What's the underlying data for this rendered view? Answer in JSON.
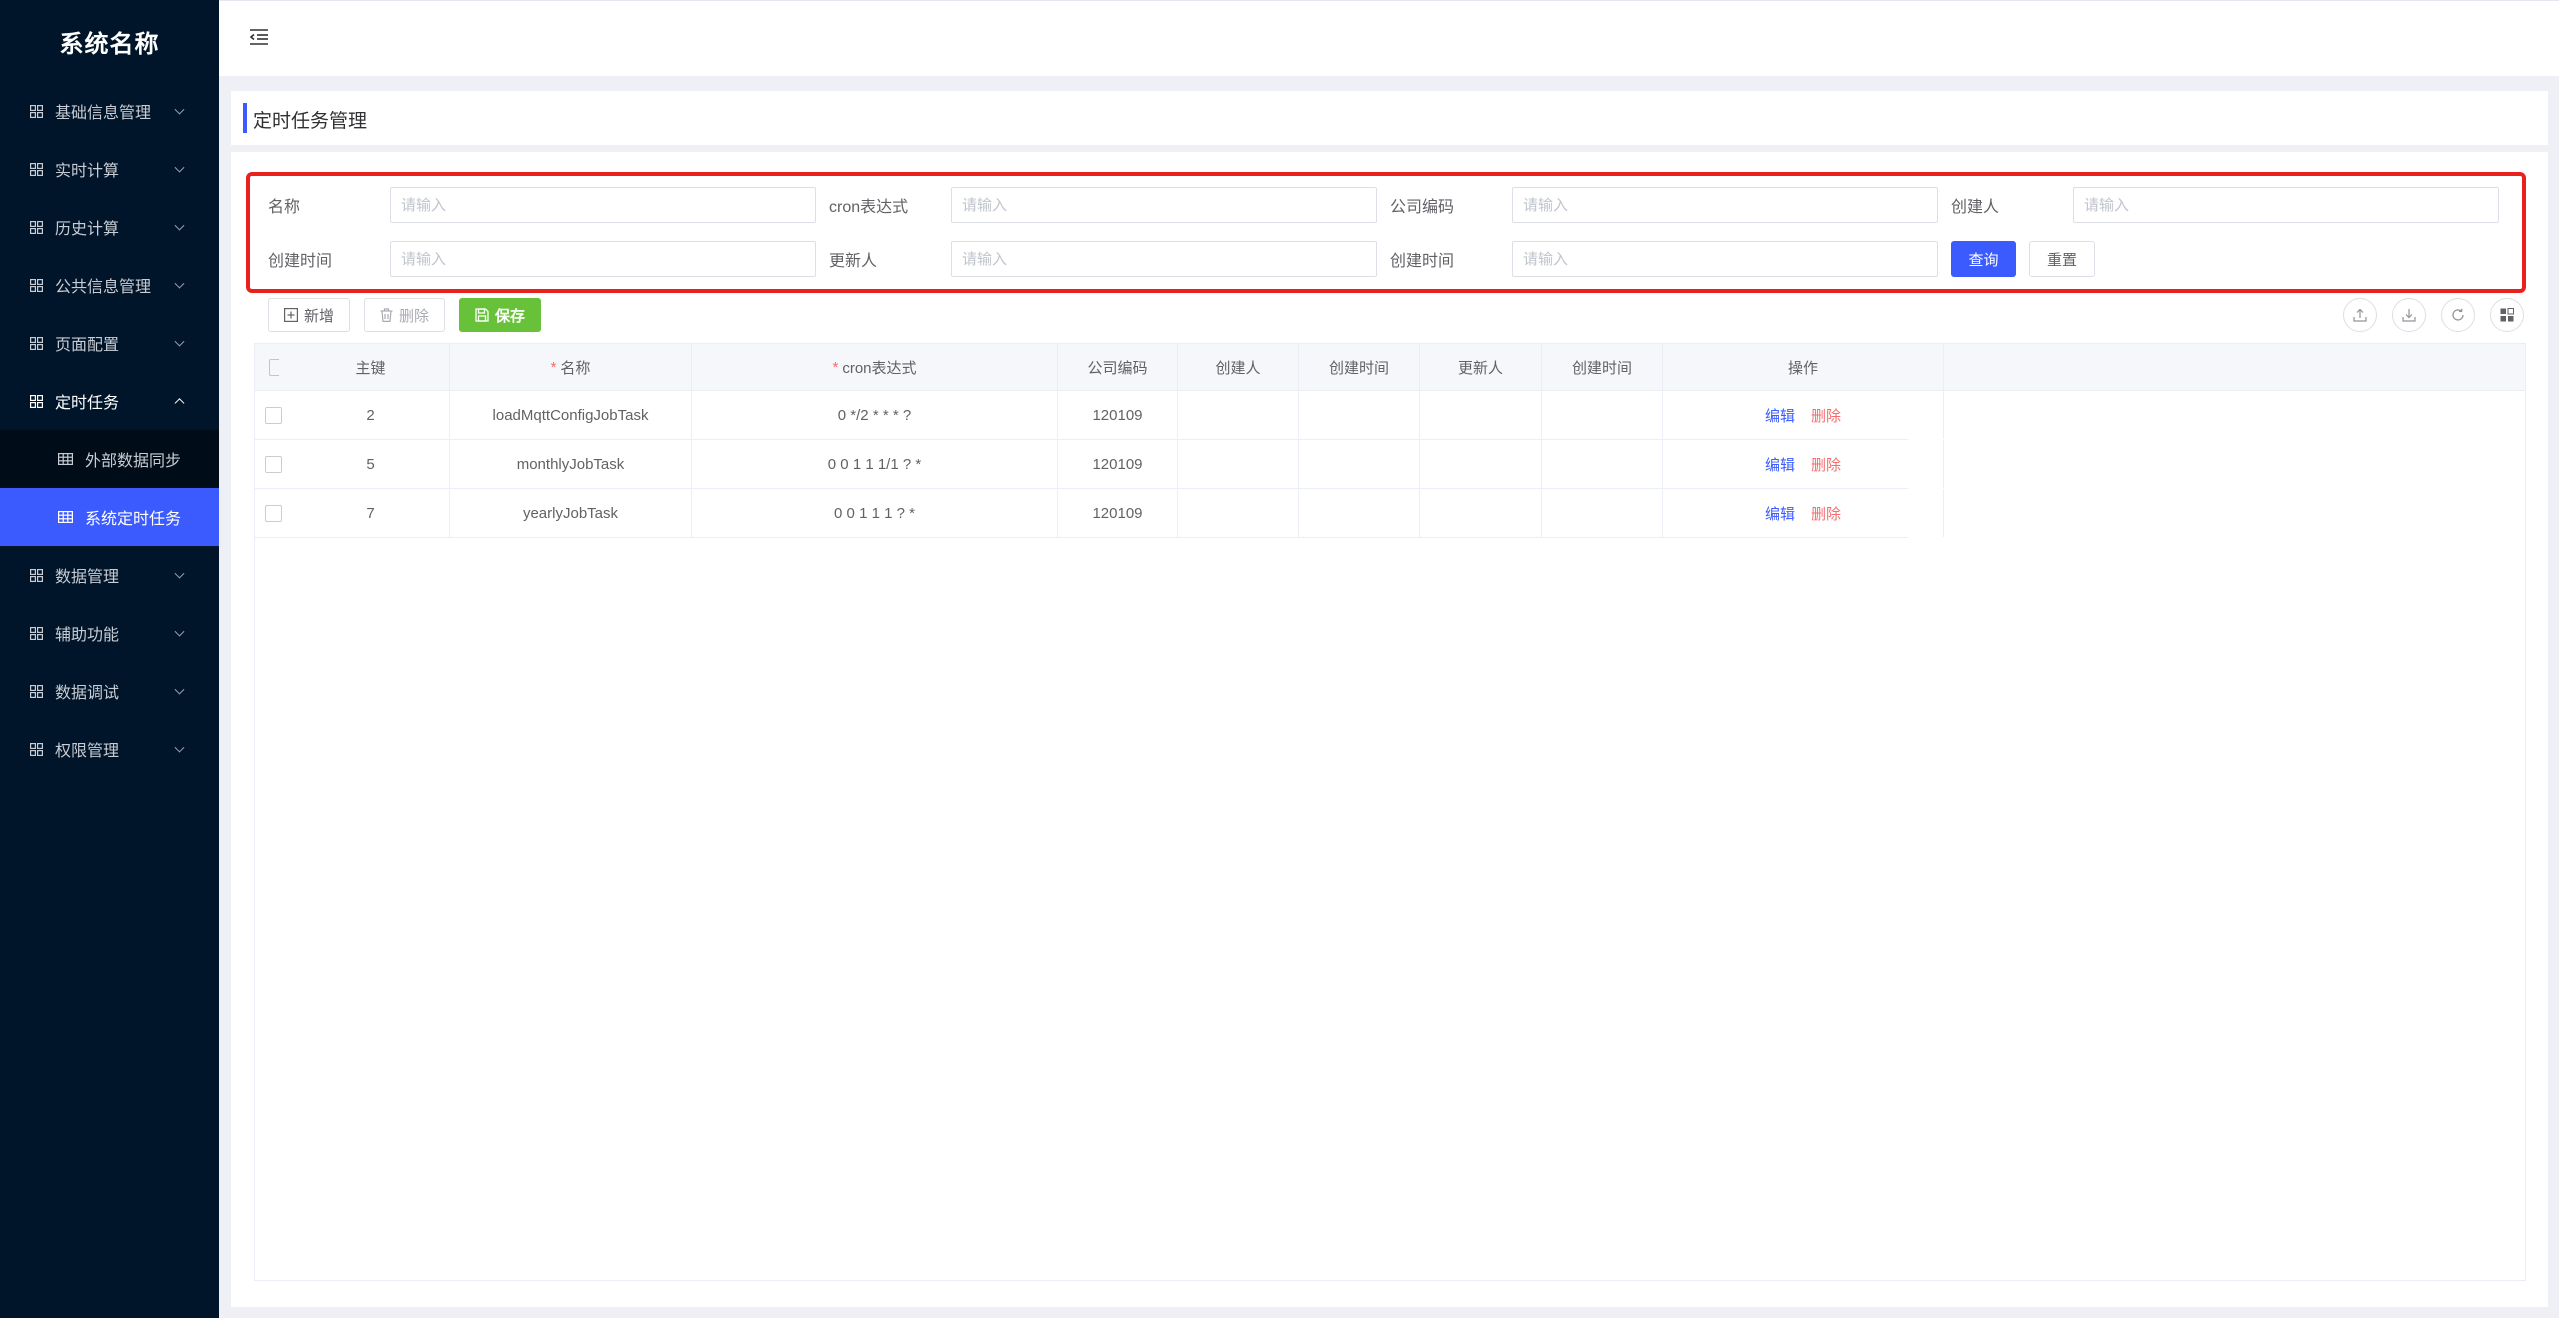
{
  "app": {
    "name": "系统名称"
  },
  "sidebar": {
    "items": [
      {
        "label": "基础信息管理"
      },
      {
        "label": "实时计算"
      },
      {
        "label": "历史计算"
      },
      {
        "label": "公共信息管理"
      },
      {
        "label": "页面配置"
      },
      {
        "label": "定时任务",
        "open": true,
        "children": [
          {
            "label": "外部数据同步"
          },
          {
            "label": "系统定时任务",
            "active": true
          }
        ]
      },
      {
        "label": "数据管理"
      },
      {
        "label": "辅助功能"
      },
      {
        "label": "数据调试"
      },
      {
        "label": "权限管理"
      }
    ]
  },
  "page": {
    "title": "定时任务管理"
  },
  "search": {
    "placeholder": "请输入",
    "fields": [
      "名称",
      "cron表达式",
      "公司编码",
      "创建人",
      "创建时间",
      "更新人",
      "创建时间"
    ],
    "query_label": "查询",
    "reset_label": "重置"
  },
  "toolbar": {
    "add_label": "新增",
    "delete_label": "删除",
    "save_label": "保存"
  },
  "table": {
    "columns": [
      "主键",
      "名称",
      "cron表达式",
      "公司编码",
      "创建人",
      "创建时间",
      "更新人",
      "创建时间",
      "操作"
    ],
    "rows": [
      {
        "id": "2",
        "name": "loadMqttConfigJobTask",
        "cron": "0 */2 * * * ?",
        "company": "120109",
        "creator": "",
        "created": "",
        "updater": "",
        "created2": ""
      },
      {
        "id": "5",
        "name": "monthlyJobTask",
        "cron": "0 0 1 1 1/1 ? *",
        "company": "120109",
        "creator": "",
        "created": "",
        "updater": "",
        "created2": ""
      },
      {
        "id": "7",
        "name": "yearlyJobTask",
        "cron": "0 0 1 1 1 ? *",
        "company": "120109",
        "creator": "",
        "created": "",
        "updater": "",
        "created2": ""
      }
    ],
    "edit_label": "编辑",
    "delete_label": "删除"
  },
  "colors": {
    "sidebar_bg": "#001529",
    "primary": "#3b5bff",
    "success": "#67c23a",
    "danger": "#f56c6c",
    "highlight": "#e8211d"
  }
}
